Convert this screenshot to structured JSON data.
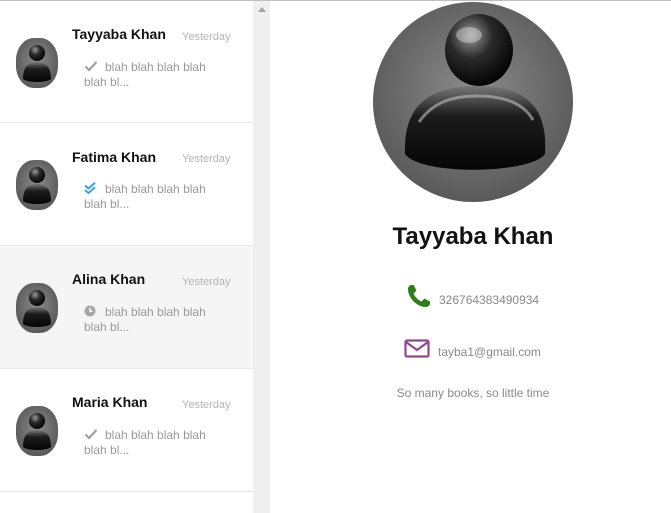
{
  "chats": [
    {
      "name": "Tayyaba Khan",
      "time": "Yesterday",
      "status": "sent",
      "preview": "blah blah blah blah blah bl...",
      "active": false
    },
    {
      "name": "Fatima Khan",
      "time": "Yesterday",
      "status": "read",
      "preview": "blah blah blah blah blah bl...",
      "active": false
    },
    {
      "name": "Alina Khan",
      "time": "Yesterday",
      "status": "pending",
      "preview": "blah blah blah blah blah bl...",
      "active": true
    },
    {
      "name": "Maria Khan",
      "time": "Yesterday",
      "status": "sent",
      "preview": "blah blah blah blah blah bl...",
      "active": false
    }
  ],
  "status_icons": {
    "sent": "single-check-icon",
    "read": "double-check-icon",
    "pending": "clock-icon"
  },
  "profile": {
    "name": "Tayyaba Khan",
    "phone": "326764383490934",
    "email": "tayba1@gmail.com",
    "bio": "So many books, so little time"
  },
  "colors": {
    "read_check": "#3aa0e0",
    "sent_check": "#a0a0a0",
    "phone_icon": "#2e7d1a",
    "mail_icon": "#8a4a8c"
  }
}
